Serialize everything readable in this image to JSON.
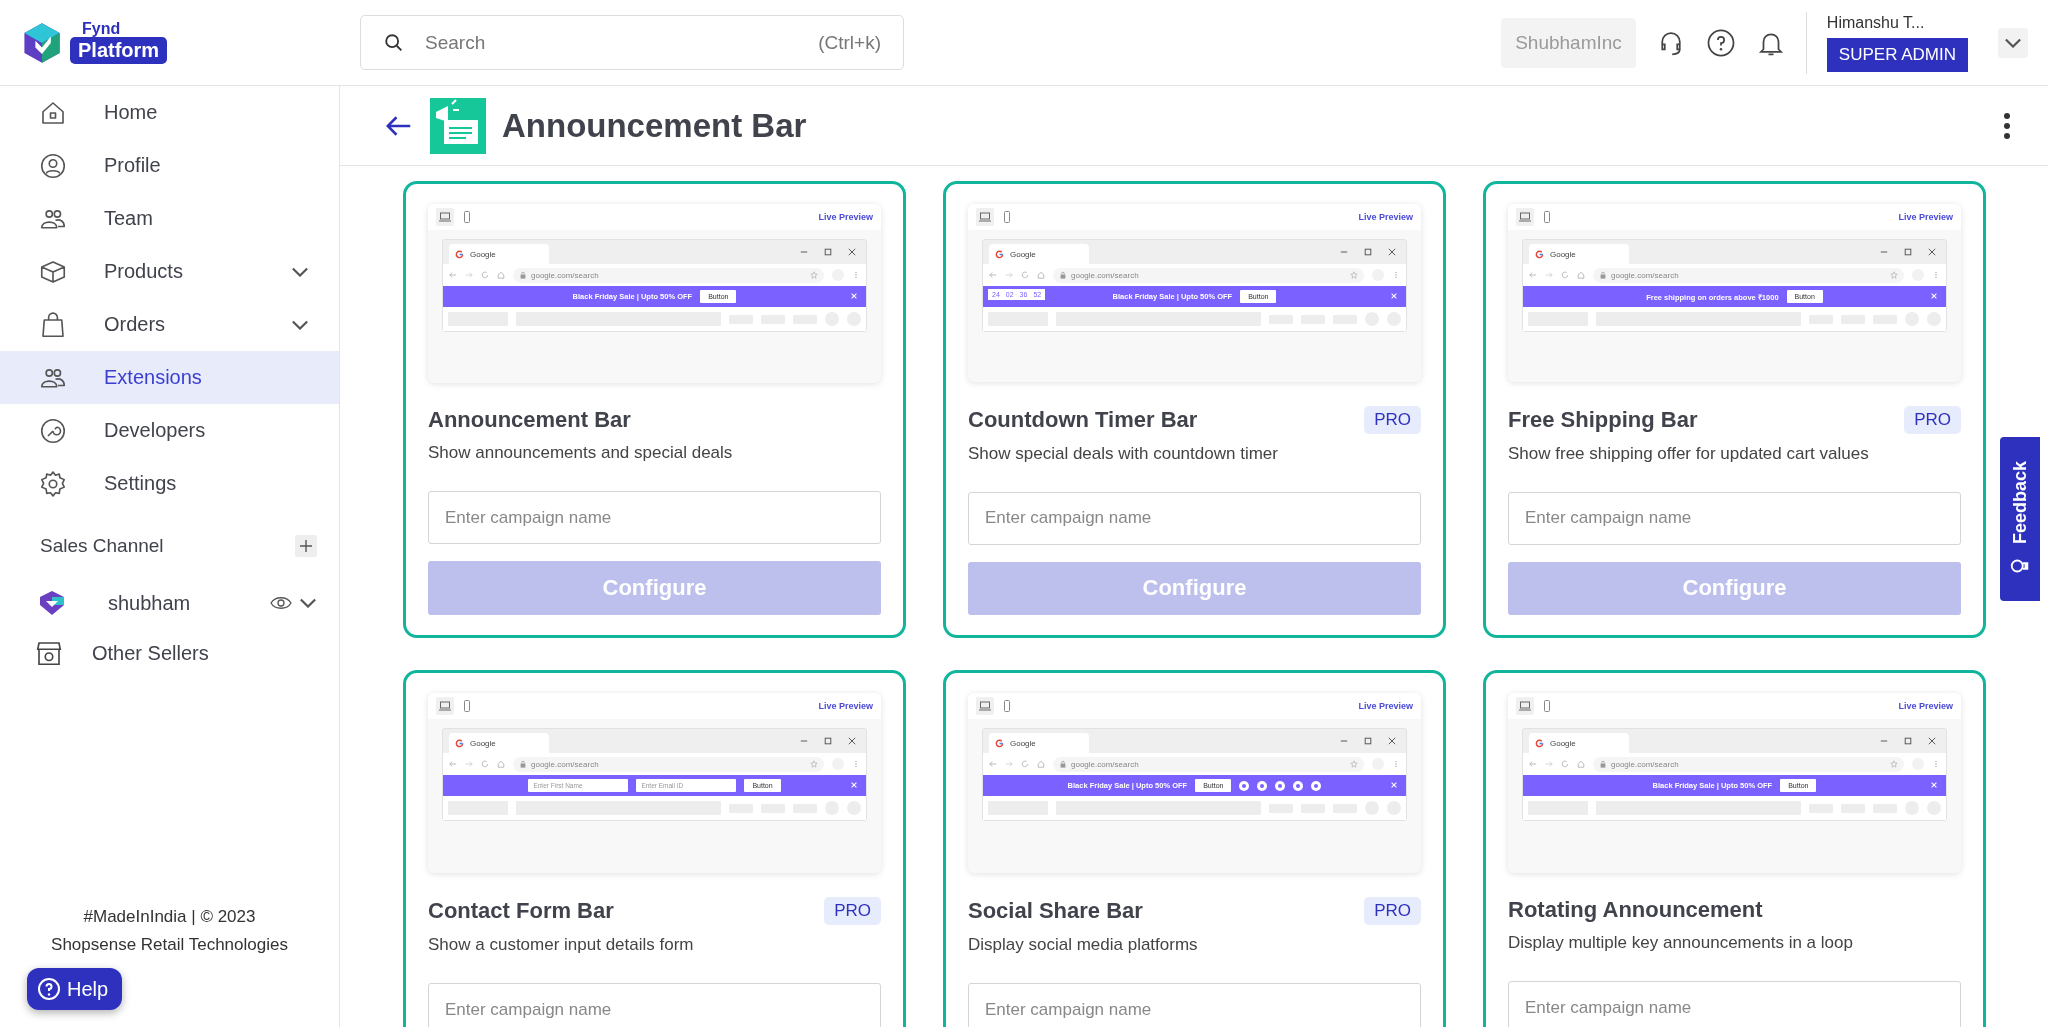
{
  "brand": {
    "top": "Fynd",
    "bottom": "Platform"
  },
  "search": {
    "placeholder": "Search",
    "shortcut": "(Ctrl+k)"
  },
  "header": {
    "company": "ShubhamInc",
    "user_name": "Himanshu T...",
    "role": "SUPER ADMIN"
  },
  "sidebar": {
    "items": [
      {
        "label": "Home",
        "kind": "link",
        "selected": false
      },
      {
        "label": "Profile",
        "kind": "link",
        "selected": false
      },
      {
        "label": "Team",
        "kind": "link",
        "selected": false
      },
      {
        "label": "Products",
        "kind": "group",
        "expanded": false,
        "selected": false
      },
      {
        "label": "Orders",
        "kind": "group",
        "expanded": false,
        "selected": false
      },
      {
        "label": "Extensions",
        "kind": "link",
        "selected": true
      },
      {
        "label": "Developers",
        "kind": "link",
        "selected": false
      },
      {
        "label": "Settings",
        "kind": "link",
        "selected": false
      }
    ],
    "sales_channel": {
      "title": "Sales Channel",
      "channels": [
        {
          "label": "shubham",
          "expanded": false
        }
      ]
    },
    "other_sellers": "Other Sellers",
    "footer": [
      "#MadeInIndia | © 2023",
      "Shopsense Retail Technologies"
    ],
    "help": "Help"
  },
  "page": {
    "title": "Announcement Bar"
  },
  "cards": [
    {
      "title": "Announcement Bar",
      "description": "Show announcements and special deals",
      "placeholder": "Enter campaign name",
      "button": "Configure",
      "disabled": true,
      "preview": {
        "kind": "banner",
        "live_label": "Live Preview",
        "tab": "Google",
        "url": "google.com/search",
        "message": "Black Friday Sale | Upto 50% OFF",
        "button": "Button"
      }
    },
    {
      "title": "Countdown Timer Bar",
      "badge": "PRO",
      "description": "Show special deals with countdown timer",
      "placeholder": "Enter campaign name",
      "button": "Configure",
      "disabled": true,
      "preview": {
        "kind": "countdown",
        "live_label": "Live Preview",
        "tab": "Google",
        "url": "google.com/search",
        "message": "Black Friday Sale | Upto 50% OFF",
        "button": "Button",
        "timer": [
          "24",
          "02",
          "36",
          "52"
        ]
      }
    },
    {
      "title": "Free Shipping Bar",
      "badge": "PRO",
      "description": "Show free shipping offer for updated cart values",
      "placeholder": "Enter campaign name",
      "button": "Configure",
      "disabled": true,
      "preview": {
        "kind": "banner",
        "live_label": "Live Preview",
        "tab": "Google",
        "url": "google.com/search",
        "message": "Free shipping on orders above ₹1000",
        "button": "Button"
      }
    },
    {
      "title": "Contact Form Bar",
      "badge": "PRO",
      "description": "Show a customer input details form",
      "placeholder": "Enter campaign name",
      "preview": {
        "kind": "form",
        "live_label": "Live Preview",
        "tab": "Google",
        "url": "google.com/search",
        "fields": [
          "Enter First Name",
          "Enter Email ID"
        ],
        "button": "Button"
      }
    },
    {
      "title": "Social Share Bar",
      "badge": "PRO",
      "description": "Display social media platforms",
      "placeholder": "Enter campaign name",
      "preview": {
        "kind": "social",
        "live_label": "Live Preview",
        "tab": "Google",
        "url": "google.com/search",
        "message": "Black Friday Sale | Upto 50% OFF",
        "button": "Button"
      }
    },
    {
      "title": "Rotating Announcement",
      "description": "Display multiple key announcements in a loop",
      "placeholder": "Enter campaign name",
      "preview": {
        "kind": "banner",
        "live_label": "Live Preview",
        "tab": "Google",
        "url": "google.com/search",
        "message": "Black Friday Sale | Upto 50% OFF",
        "button": "Button"
      }
    }
  ],
  "feedback": "Feedback"
}
